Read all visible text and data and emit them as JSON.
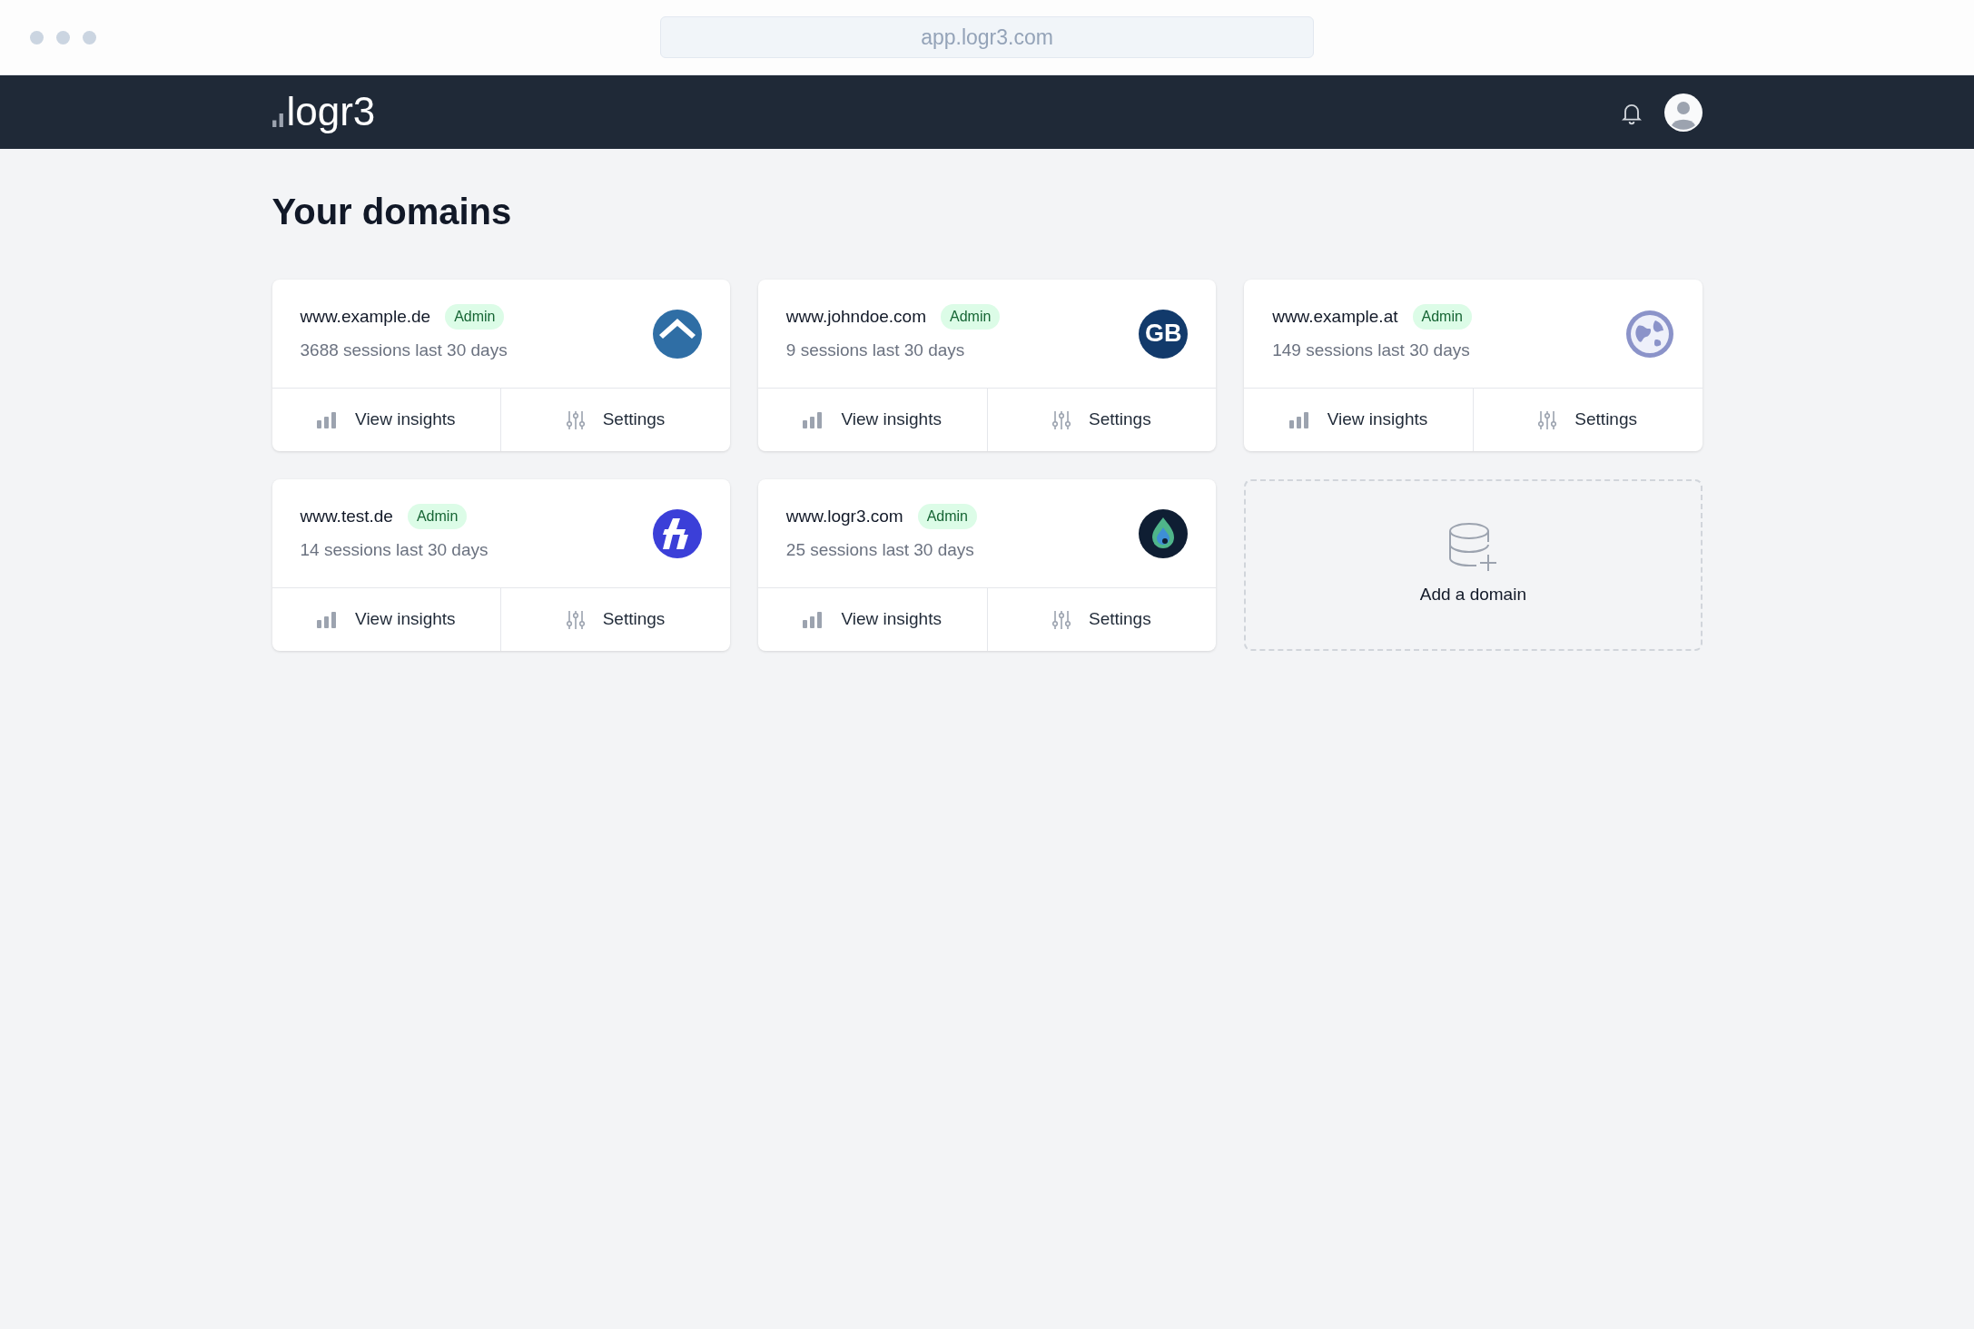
{
  "browser": {
    "url": "app.logr3.com"
  },
  "navbar": {
    "brand": "logr3"
  },
  "page_title": "Your domains",
  "domains": [
    {
      "name": "www.example.de",
      "role": "Admin",
      "sessions": "3688 sessions last 30 days",
      "logo": {
        "kind": "house"
      },
      "actions": [
        "View insights",
        "Settings"
      ]
    },
    {
      "name": "www.johndoe.com",
      "role": "Admin",
      "sessions": "9 sessions last 30 days",
      "logo": {
        "kind": "monogram",
        "text": "GB"
      },
      "actions": [
        "View insights",
        "Settings"
      ]
    },
    {
      "name": "www.example.at",
      "role": "Admin",
      "sessions": "149 sessions last 30 days",
      "logo": {
        "kind": "globe"
      },
      "actions": [
        "View insights",
        "Settings"
      ]
    },
    {
      "name": "www.test.de",
      "role": "Admin",
      "sessions": "14 sessions last 30 days",
      "logo": {
        "kind": "bolt"
      },
      "actions": [
        "View insights",
        "Settings"
      ]
    },
    {
      "name": "www.logr3.com",
      "role": "Admin",
      "sessions": "25 sessions last 30 days",
      "logo": {
        "kind": "drop"
      },
      "actions": [
        "View insights",
        "Settings"
      ]
    }
  ],
  "add_domain": {
    "label": "Add a domain"
  }
}
